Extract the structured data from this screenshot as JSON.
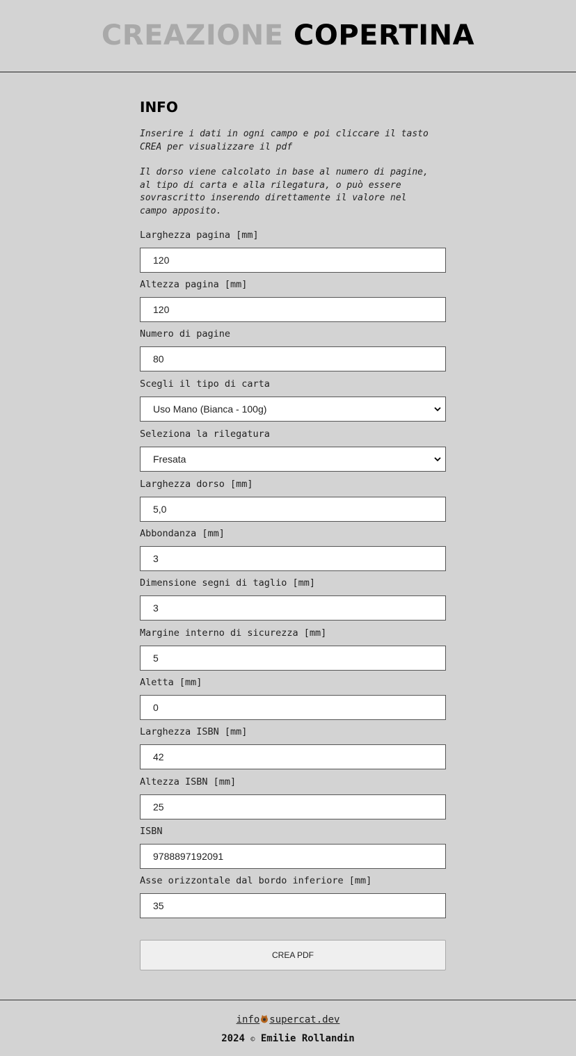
{
  "header": {
    "title_light": "CREAZIONE",
    "title_dark": "COPERTINA"
  },
  "info": {
    "title": "INFO",
    "paragraph1": "Inserire i dati in ogni campo e poi cliccare il tasto\nCREA per visualizzare il pdf",
    "paragraph2": "Il dorso viene calcolato in base al numero di pagine,\nal tipo di carta e alla rilegatura, o può essere\nsovrascritto inserendo direttamente il valore nel\ncampo apposito."
  },
  "fields": [
    {
      "label": "Larghezza pagina [mm]",
      "value": "120",
      "type": "input"
    },
    {
      "label": "Altezza pagina [mm]",
      "value": "120",
      "type": "input"
    },
    {
      "label": "Numero di pagine",
      "value": "80",
      "type": "input"
    },
    {
      "label": "Scegli il tipo di carta",
      "value": "Uso Mano (Bianca - 100g)",
      "type": "select"
    },
    {
      "label": "Seleziona la rilegatura",
      "value": "Fresata",
      "type": "select"
    },
    {
      "label": "Larghezza dorso [mm]",
      "value": "5,0",
      "type": "input"
    },
    {
      "label": "Abbondanza [mm]",
      "value": "3",
      "type": "input"
    },
    {
      "label": "Dimensione segni di taglio [mm]",
      "value": "3",
      "type": "input"
    },
    {
      "label": "Margine interno di sicurezza [mm]",
      "value": "5",
      "type": "input"
    },
    {
      "label": "Aletta [mm]",
      "value": "0",
      "type": "input"
    },
    {
      "label": "Larghezza ISBN [mm]",
      "value": "42",
      "type": "input"
    },
    {
      "label": "Altezza ISBN [mm]",
      "value": "25",
      "type": "input"
    },
    {
      "label": "ISBN",
      "value": "9788897192091",
      "type": "input"
    },
    {
      "label": "Asse orizzontale dal bordo inferiore [mm]",
      "value": "35",
      "type": "input"
    }
  ],
  "actions": {
    "create_label": "CREA PDF"
  },
  "footer": {
    "email_user": "info",
    "email_domain": "supercat.dev",
    "year": "2024",
    "copyright_symbol": "©",
    "author": "Emilie Rollandin"
  },
  "colors": {
    "background": "#d3d3d3",
    "title_light": "#a9a9a9",
    "title_dark": "#000000"
  }
}
